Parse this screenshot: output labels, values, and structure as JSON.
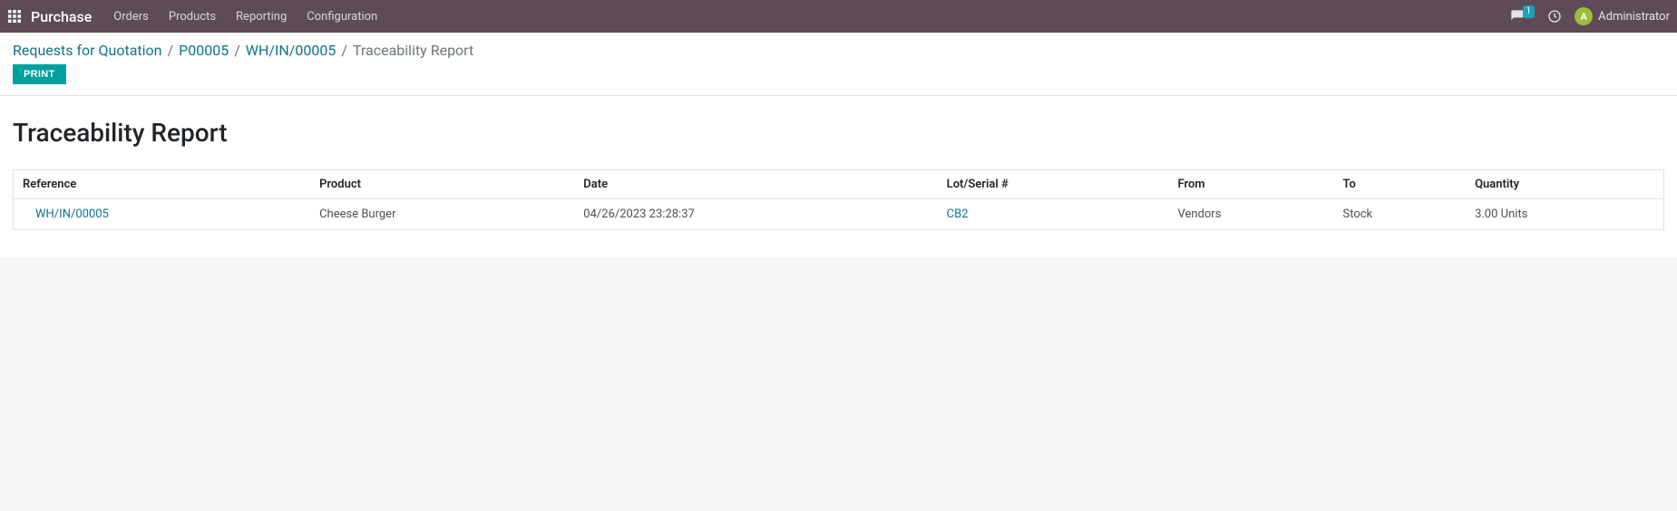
{
  "navbar": {
    "brand": "Purchase",
    "menu": [
      "Orders",
      "Products",
      "Reporting",
      "Configuration"
    ],
    "chat_count": "1",
    "user_initial": "A",
    "user_name": "Administrator"
  },
  "breadcrumbs": {
    "items": [
      {
        "label": "Requests for Quotation",
        "link": true
      },
      {
        "label": "P00005",
        "link": true
      },
      {
        "label": "WH/IN/00005",
        "link": true
      },
      {
        "label": "Traceability Report",
        "link": false
      }
    ],
    "sep": "/"
  },
  "actions": {
    "print_label": "PRINT"
  },
  "page": {
    "title": "Traceability Report"
  },
  "table": {
    "headers": {
      "reference": "Reference",
      "product": "Product",
      "date": "Date",
      "lot": "Lot/Serial #",
      "from": "From",
      "to": "To",
      "qty": "Quantity"
    },
    "rows": [
      {
        "reference": "WH/IN/00005",
        "product": "Cheese Burger",
        "date": "04/26/2023 23:28:37",
        "lot": "CB2",
        "from": "Vendors",
        "to": "Stock",
        "qty": "3.00 Units"
      }
    ]
  }
}
